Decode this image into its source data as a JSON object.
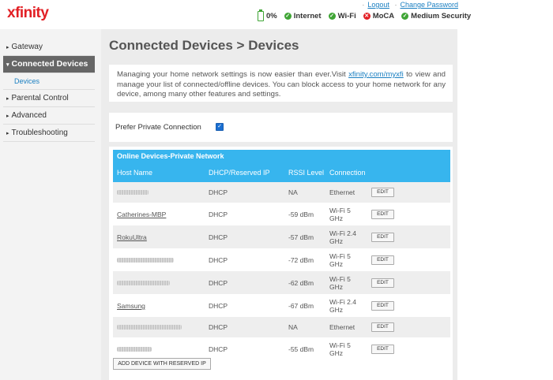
{
  "brand": {
    "logo": "xfinity"
  },
  "top_links": {
    "logout": "Logout",
    "change_password": "Change Password"
  },
  "status": [
    {
      "label": "0%",
      "icon": "battery-icon"
    },
    {
      "label": "Internet",
      "icon": "check-icon"
    },
    {
      "label": "Wi-Fi",
      "icon": "check-icon"
    },
    {
      "label": "MoCA",
      "icon": "cross-icon"
    },
    {
      "label": "Medium Security",
      "icon": "check-icon"
    }
  ],
  "sidebar": {
    "items": [
      {
        "label": "Gateway",
        "arrow": "▸"
      },
      {
        "label": "Connected Devices",
        "arrow": "▾"
      },
      {
        "label": "Devices"
      },
      {
        "label": "Parental Control",
        "arrow": "▸"
      },
      {
        "label": "Advanced",
        "arrow": "▸"
      },
      {
        "label": "Troubleshooting",
        "arrow": "▸"
      }
    ]
  },
  "main": {
    "title": "Connected Devices > Devices",
    "info_text_before": "Managing your home network settings is now easier than ever.Visit ",
    "info_link": "xfinity.com/myxfi",
    "info_text_after": " to view and manage your list of connected/offline devices. You can block access to your home network for any device, among many other features and settings.",
    "prefer_private_label": "Prefer Private Connection",
    "prefer_private_checked": true
  },
  "table": {
    "title": "Online Devices-Private Network",
    "columns": [
      "Host Name",
      "DHCP/Reserved IP",
      "RSSI Level",
      "Connection"
    ],
    "rows": [
      {
        "host": "",
        "ip": "DHCP",
        "rssi": "NA",
        "conn1": "Ethernet",
        "conn2": "",
        "edit": "EDIT"
      },
      {
        "host": "Catherines-MBP",
        "ip": "DHCP",
        "rssi": "-59 dBm",
        "conn1": "Wi-Fi 5",
        "conn2": "GHz",
        "edit": "EDIT"
      },
      {
        "host": "RokuUltra",
        "ip": "DHCP",
        "rssi": "-57 dBm",
        "conn1": "Wi-Fi 2.4",
        "conn2": "GHz",
        "edit": "EDIT"
      },
      {
        "host": "",
        "ip": "DHCP",
        "rssi": "-72 dBm",
        "conn1": "Wi-Fi 5",
        "conn2": "GHz",
        "edit": "EDIT"
      },
      {
        "host": "",
        "ip": "DHCP",
        "rssi": "-62 dBm",
        "conn1": "Wi-Fi 5",
        "conn2": "GHz",
        "edit": "EDIT"
      },
      {
        "host": "Samsung",
        "ip": "DHCP",
        "rssi": "-67 dBm",
        "conn1": "Wi-Fi 2.4",
        "conn2": "GHz",
        "edit": "EDIT"
      },
      {
        "host": "",
        "ip": "DHCP",
        "rssi": "NA",
        "conn1": "Ethernet",
        "conn2": "",
        "edit": "EDIT"
      },
      {
        "host": "",
        "ip": "DHCP",
        "rssi": "-55 dBm",
        "conn1": "Wi-Fi 5",
        "conn2": "GHz",
        "edit": "EDIT"
      }
    ],
    "add_button": "ADD DEVICE WITH RESERVED IP"
  }
}
